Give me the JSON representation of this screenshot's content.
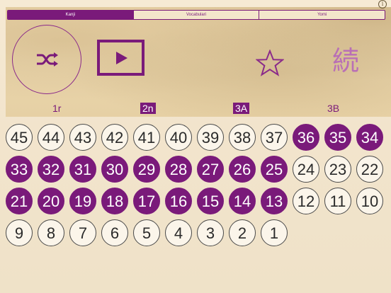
{
  "info": {
    "glyph": "i"
  },
  "tabs": [
    {
      "label": "Kanji",
      "active": true
    },
    {
      "label": "Vocabulari",
      "active": false
    },
    {
      "label": "Yomi",
      "active": false
    }
  ],
  "toolbar": {
    "shuffle_icon": "shuffle-icon",
    "play_icon": "play-icon",
    "star_icon": "star-icon",
    "kanji_glyph": "続"
  },
  "groups": [
    {
      "label": "1r",
      "active": false
    },
    {
      "label": "2n",
      "active": true
    },
    {
      "label": "3A",
      "active": true
    },
    {
      "label": "3B",
      "active": false
    }
  ],
  "lessons": {
    "rows": [
      [
        45,
        44,
        43,
        42,
        41,
        40,
        39,
        38,
        37,
        36,
        35,
        34
      ],
      [
        33,
        32,
        31,
        30,
        29,
        28,
        27,
        26,
        25,
        24,
        23,
        22
      ],
      [
        21,
        20,
        19,
        18,
        17,
        16,
        15,
        14,
        13,
        12,
        11,
        10
      ],
      [
        9,
        8,
        7,
        6,
        5,
        4,
        3,
        2,
        1
      ]
    ],
    "selected": [
      36,
      35,
      34,
      33,
      32,
      31,
      30,
      29,
      28,
      27,
      26,
      25,
      21,
      20,
      19,
      18,
      17,
      16,
      15,
      14,
      13
    ]
  },
  "colors": {
    "accent": "#7a1a7a",
    "kanji": "#b96fb6"
  }
}
